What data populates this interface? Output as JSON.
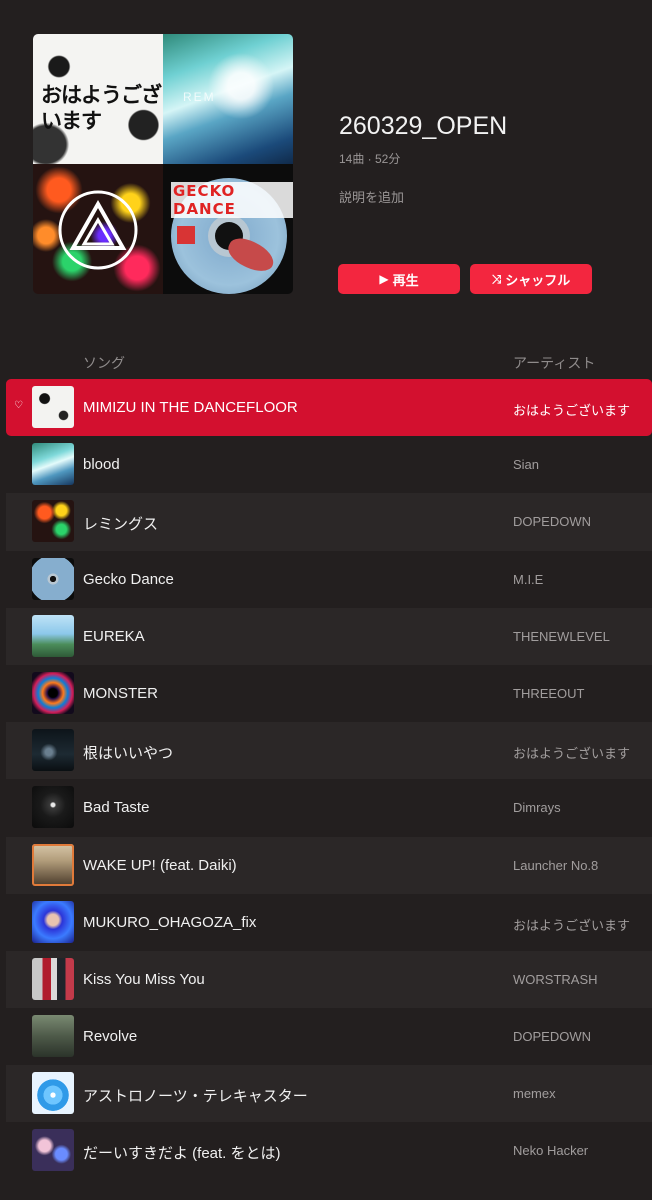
{
  "header": {
    "cover_text_top_left": "おはようございます",
    "cover_text_top_right": "REM",
    "cover_text_bottom_right": "GECKO DANCE",
    "title": "260329_OPEN",
    "meta": "14曲 · 52分",
    "add_description": "説明を追加",
    "play_label": "再生",
    "shuffle_label": "シャッフル",
    "play_icon": "▶",
    "shuffle_icon": "⤨"
  },
  "columns": {
    "song": "ソング",
    "artist": "アーティスト"
  },
  "colors": {
    "accent": "#f3263f",
    "selected_row": "#d3102f",
    "background": "#231f1f"
  },
  "tracks": [
    {
      "title": "MIMIZU IN THE DANCEFLOOR",
      "artist": "おはようございます",
      "selected": true,
      "favorite": true
    },
    {
      "title": "blood",
      "artist": "Sian"
    },
    {
      "title": "レミングス",
      "artist": "DOPEDOWN"
    },
    {
      "title": "Gecko Dance",
      "artist": "M.I.E"
    },
    {
      "title": "EUREKA",
      "artist": "THENEWLEVEL"
    },
    {
      "title": "MONSTER",
      "artist": "THREEOUT"
    },
    {
      "title": "根はいいやつ",
      "artist": "おはようございます"
    },
    {
      "title": "Bad Taste",
      "artist": "Dimrays"
    },
    {
      "title": "WAKE UP! (feat. Daiki)",
      "artist": "Launcher No.8"
    },
    {
      "title": "MUKURO_OHAGOZA_fix",
      "artist": "おはようございます"
    },
    {
      "title": "Kiss You Miss You",
      "artist": "WORSTRASH"
    },
    {
      "title": "Revolve",
      "artist": "DOPEDOWN"
    },
    {
      "title": "アストロノーツ・テレキャスター",
      "artist": "memex"
    },
    {
      "title": "だーいすきだよ (feat. をとは)",
      "artist": "Neko Hacker"
    }
  ],
  "favorite_icon": "♡"
}
